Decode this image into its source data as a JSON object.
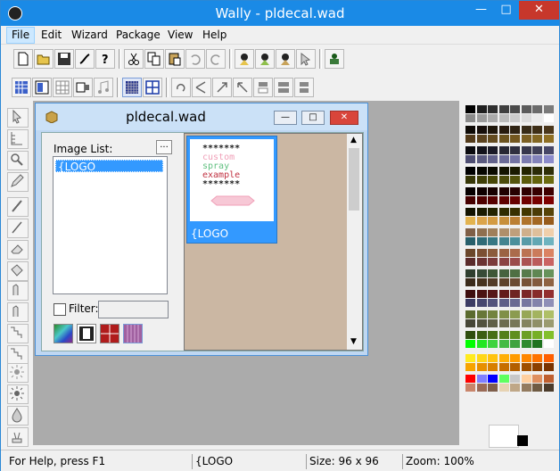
{
  "window": {
    "title": "Wally - pldecal.wad"
  },
  "menu": [
    "File",
    "Edit",
    "Wizard",
    "Package",
    "View",
    "Help"
  ],
  "child": {
    "title": "pldecal.wad"
  },
  "panel": {
    "image_list_label": "Image List:",
    "image_list_button": "...",
    "list_items": [
      "{LOGO"
    ],
    "filter_label": "Filter:",
    "filter_value": ""
  },
  "thumbnail": {
    "label": "{LOGO",
    "text_lines": [
      "*******",
      "custom",
      "spray",
      "example",
      "*******"
    ],
    "text_colors": [
      "#222222",
      "#f0a0b8",
      "#60c080",
      "#c03040",
      "#222222"
    ]
  },
  "status": {
    "help": "For Help, press F1",
    "name": "{LOGO",
    "size": "Size: 96 x 96",
    "zoom": "Zoom: 100%"
  },
  "colors": {
    "titlebar": "#1a8ae6",
    "selection": "#3399ff",
    "close": "#c7372b"
  }
}
